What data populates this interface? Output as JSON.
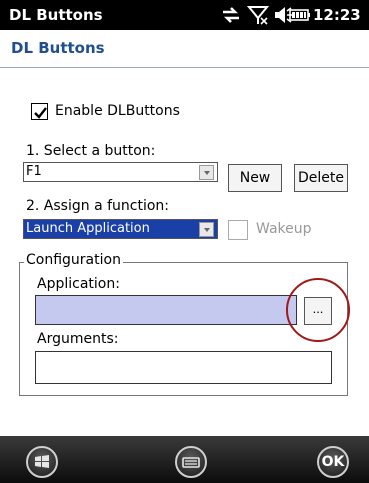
{
  "status_bar": {
    "title": "DL Buttons",
    "time": "12:23"
  },
  "header": {
    "title": "DL Buttons"
  },
  "enable_dlbuttons": {
    "label": "Enable DLButtons",
    "checked": true
  },
  "select_button": {
    "label": "1. Select a button:",
    "value": "F1"
  },
  "buttons": {
    "new": "New",
    "delete": "Delete"
  },
  "assign_function": {
    "label": "2. Assign a function:",
    "value": "Launch Application"
  },
  "wakeup": {
    "label": "Wakeup",
    "checked": false,
    "enabled": false
  },
  "configuration": {
    "legend": "Configuration",
    "application_label": "Application:",
    "application_value": "",
    "browse_label": "...",
    "arguments_label": "Arguments:",
    "arguments_value": ""
  },
  "bottom_bar": {
    "ok_label": "OK"
  },
  "colors": {
    "status_bar_bg": "#000000",
    "header_text": "#1f4f8f",
    "selection": "#1a40a8",
    "field_fill": "#c5c8ef",
    "highlight_ring": "#a01818"
  }
}
